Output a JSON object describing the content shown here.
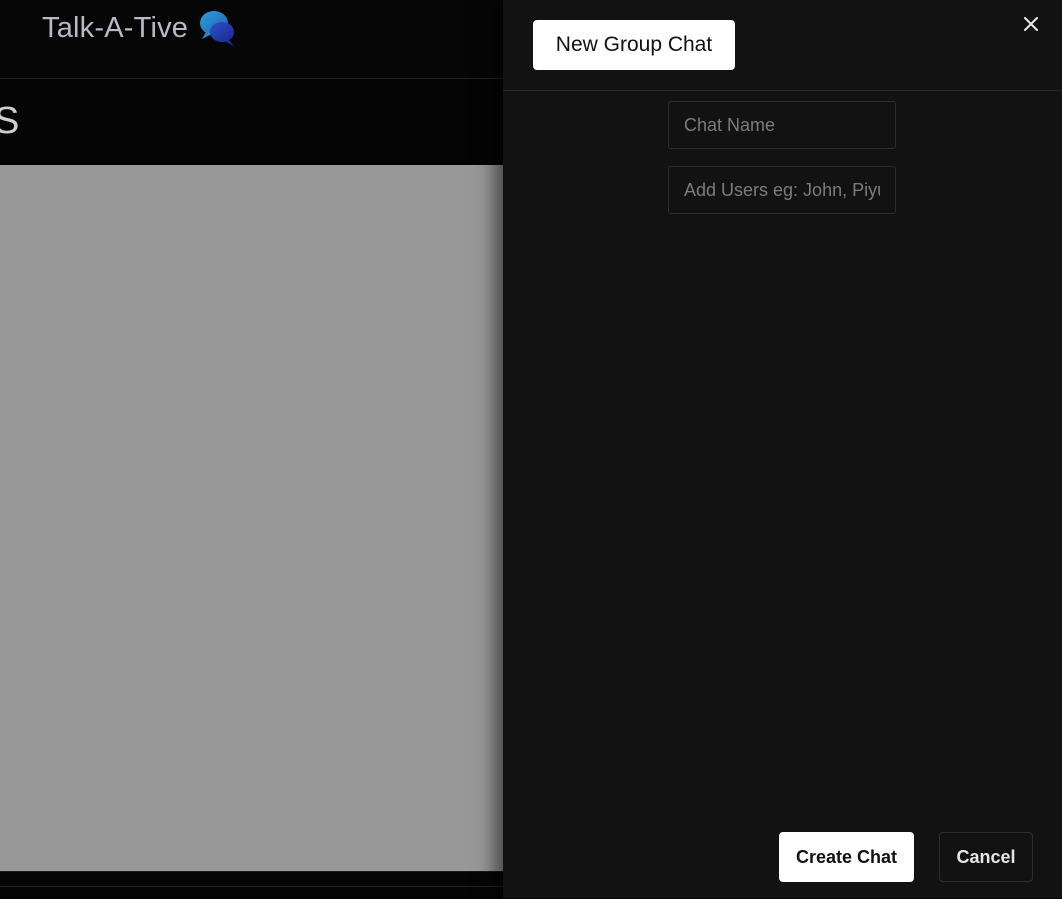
{
  "app": {
    "brand_name": "Talk-A-Tive",
    "brand_icon": "speech-bubbles-icon",
    "section_title": "S"
  },
  "drawer": {
    "title_button_label": "New Group Chat",
    "close_icon": "close-icon",
    "chat_name_placeholder": "Chat Name",
    "add_users_placeholder": "Add Users eg: John, Piyush",
    "create_label": "Create Chat",
    "cancel_label": "Cancel"
  },
  "colors": {
    "drawer_bg": "#121212",
    "overlay_content": "#989898",
    "button_bg": "#ffffff"
  }
}
